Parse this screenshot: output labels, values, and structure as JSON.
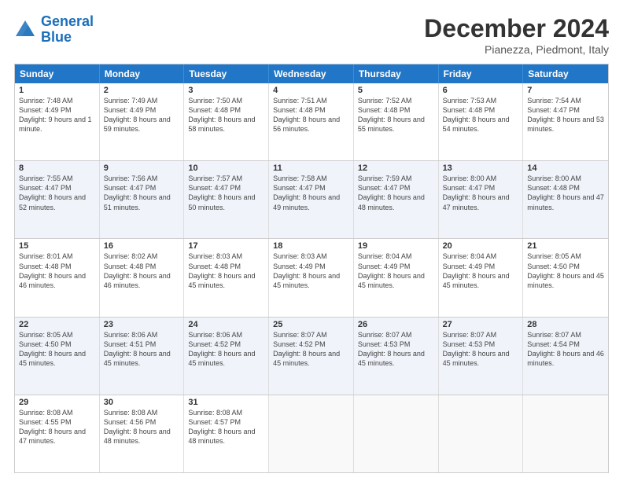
{
  "logo": {
    "line1": "General",
    "line2": "Blue"
  },
  "title": "December 2024",
  "subtitle": "Pianezza, Piedmont, Italy",
  "days": [
    "Sunday",
    "Monday",
    "Tuesday",
    "Wednesday",
    "Thursday",
    "Friday",
    "Saturday"
  ],
  "weeks": [
    [
      {
        "day": "1",
        "sunrise": "7:48 AM",
        "sunset": "4:49 PM",
        "daylight": "9 hours and 1 minute."
      },
      {
        "day": "2",
        "sunrise": "7:49 AM",
        "sunset": "4:49 PM",
        "daylight": "8 hours and 59 minutes."
      },
      {
        "day": "3",
        "sunrise": "7:50 AM",
        "sunset": "4:48 PM",
        "daylight": "8 hours and 58 minutes."
      },
      {
        "day": "4",
        "sunrise": "7:51 AM",
        "sunset": "4:48 PM",
        "daylight": "8 hours and 56 minutes."
      },
      {
        "day": "5",
        "sunrise": "7:52 AM",
        "sunset": "4:48 PM",
        "daylight": "8 hours and 55 minutes."
      },
      {
        "day": "6",
        "sunrise": "7:53 AM",
        "sunset": "4:48 PM",
        "daylight": "8 hours and 54 minutes."
      },
      {
        "day": "7",
        "sunrise": "7:54 AM",
        "sunset": "4:47 PM",
        "daylight": "8 hours and 53 minutes."
      }
    ],
    [
      {
        "day": "8",
        "sunrise": "7:55 AM",
        "sunset": "4:47 PM",
        "daylight": "8 hours and 52 minutes."
      },
      {
        "day": "9",
        "sunrise": "7:56 AM",
        "sunset": "4:47 PM",
        "daylight": "8 hours and 51 minutes."
      },
      {
        "day": "10",
        "sunrise": "7:57 AM",
        "sunset": "4:47 PM",
        "daylight": "8 hours and 50 minutes."
      },
      {
        "day": "11",
        "sunrise": "7:58 AM",
        "sunset": "4:47 PM",
        "daylight": "8 hours and 49 minutes."
      },
      {
        "day": "12",
        "sunrise": "7:59 AM",
        "sunset": "4:47 PM",
        "daylight": "8 hours and 48 minutes."
      },
      {
        "day": "13",
        "sunrise": "8:00 AM",
        "sunset": "4:47 PM",
        "daylight": "8 hours and 47 minutes."
      },
      {
        "day": "14",
        "sunrise": "8:00 AM",
        "sunset": "4:48 PM",
        "daylight": "8 hours and 47 minutes."
      }
    ],
    [
      {
        "day": "15",
        "sunrise": "8:01 AM",
        "sunset": "4:48 PM",
        "daylight": "8 hours and 46 minutes."
      },
      {
        "day": "16",
        "sunrise": "8:02 AM",
        "sunset": "4:48 PM",
        "daylight": "8 hours and 46 minutes."
      },
      {
        "day": "17",
        "sunrise": "8:03 AM",
        "sunset": "4:48 PM",
        "daylight": "8 hours and 45 minutes."
      },
      {
        "day": "18",
        "sunrise": "8:03 AM",
        "sunset": "4:49 PM",
        "daylight": "8 hours and 45 minutes."
      },
      {
        "day": "19",
        "sunrise": "8:04 AM",
        "sunset": "4:49 PM",
        "daylight": "8 hours and 45 minutes."
      },
      {
        "day": "20",
        "sunrise": "8:04 AM",
        "sunset": "4:49 PM",
        "daylight": "8 hours and 45 minutes."
      },
      {
        "day": "21",
        "sunrise": "8:05 AM",
        "sunset": "4:50 PM",
        "daylight": "8 hours and 45 minutes."
      }
    ],
    [
      {
        "day": "22",
        "sunrise": "8:05 AM",
        "sunset": "4:50 PM",
        "daylight": "8 hours and 45 minutes."
      },
      {
        "day": "23",
        "sunrise": "8:06 AM",
        "sunset": "4:51 PM",
        "daylight": "8 hours and 45 minutes."
      },
      {
        "day": "24",
        "sunrise": "8:06 AM",
        "sunset": "4:52 PM",
        "daylight": "8 hours and 45 minutes."
      },
      {
        "day": "25",
        "sunrise": "8:07 AM",
        "sunset": "4:52 PM",
        "daylight": "8 hours and 45 minutes."
      },
      {
        "day": "26",
        "sunrise": "8:07 AM",
        "sunset": "4:53 PM",
        "daylight": "8 hours and 45 minutes."
      },
      {
        "day": "27",
        "sunrise": "8:07 AM",
        "sunset": "4:53 PM",
        "daylight": "8 hours and 45 minutes."
      },
      {
        "day": "28",
        "sunrise": "8:07 AM",
        "sunset": "4:54 PM",
        "daylight": "8 hours and 46 minutes."
      }
    ],
    [
      {
        "day": "29",
        "sunrise": "8:08 AM",
        "sunset": "4:55 PM",
        "daylight": "8 hours and 47 minutes."
      },
      {
        "day": "30",
        "sunrise": "8:08 AM",
        "sunset": "4:56 PM",
        "daylight": "8 hours and 48 minutes."
      },
      {
        "day": "31",
        "sunrise": "8:08 AM",
        "sunset": "4:57 PM",
        "daylight": "8 hours and 48 minutes."
      },
      null,
      null,
      null,
      null
    ]
  ]
}
